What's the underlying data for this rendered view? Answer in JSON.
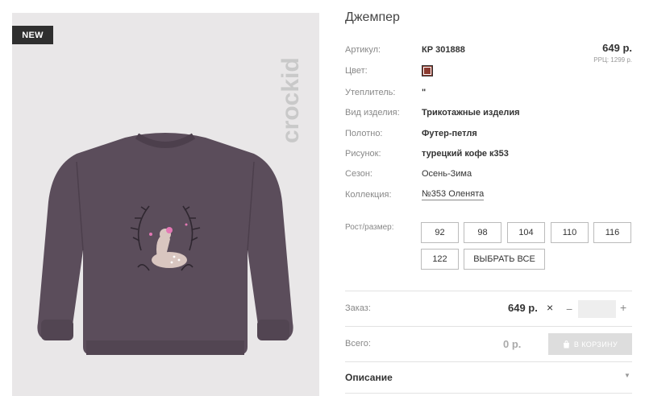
{
  "product": {
    "title": "Джемпер",
    "badge": "NEW",
    "brand": "crockid"
  },
  "price": {
    "main": "649 р.",
    "rrp": "РРЦ: 1299 р."
  },
  "specs": [
    {
      "label": "Артикул:",
      "value": "КР 301888"
    },
    {
      "label": "Цвет:",
      "value": ""
    },
    {
      "label": "Утеплитель:",
      "value": "\""
    },
    {
      "label": "Вид изделия:",
      "value": "Трикотажные изделия"
    },
    {
      "label": "Полотно:",
      "value": "Футер-петля"
    },
    {
      "label": "Рисунок:",
      "value": "турецкий кофе к353"
    },
    {
      "label": "Сезон:",
      "value": "Осень-Зима"
    },
    {
      "label": "Коллекция:",
      "value": "№353 Оленята"
    }
  ],
  "color_swatch": "#8b3a2f",
  "sizes": {
    "label": "Рост/размер:",
    "options": [
      "92",
      "98",
      "104",
      "110",
      "116",
      "122"
    ],
    "select_all": "ВЫБРАТЬ ВСЕ"
  },
  "order": {
    "label": "Заказ:",
    "unit_price": "649 р.",
    "times": "×",
    "minus": "−",
    "plus": "+",
    "quantity": ""
  },
  "total": {
    "label": "Всего:",
    "value": "0 р.",
    "cart_button": "В КОРЗИНУ"
  },
  "description": {
    "title": "Описание"
  }
}
